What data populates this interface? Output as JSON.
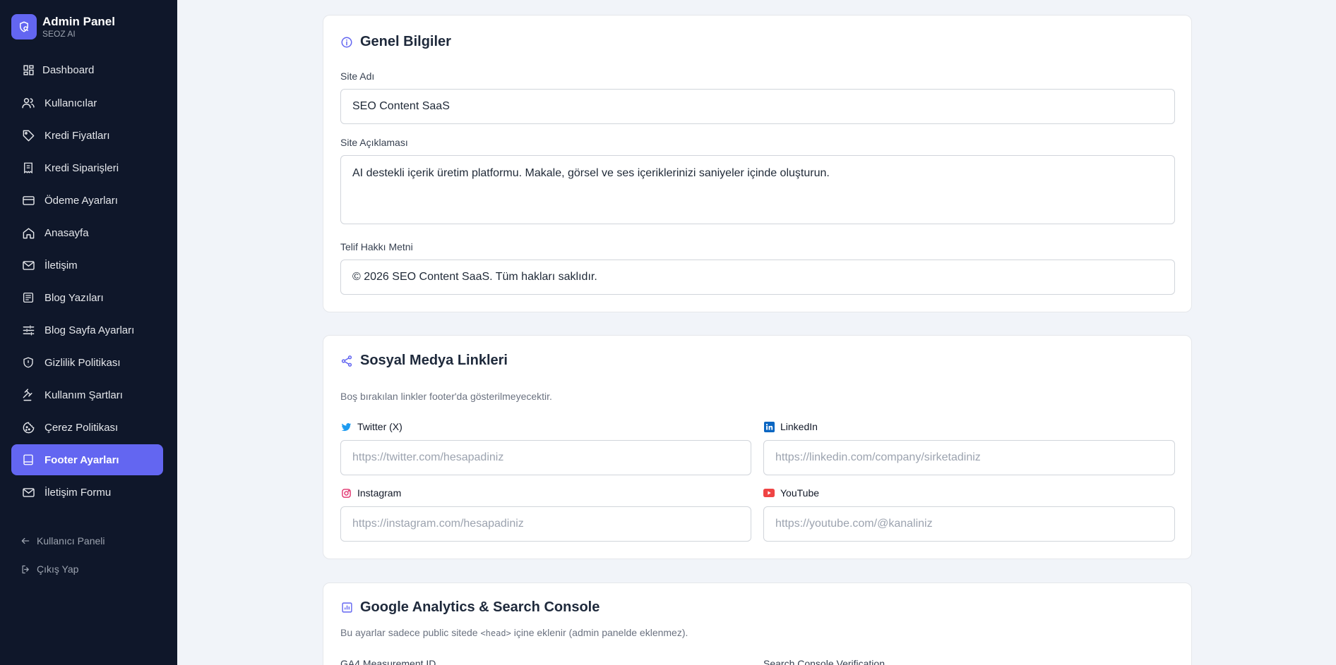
{
  "brand": {
    "title": "Admin Panel",
    "subtitle": "SEOZ AI"
  },
  "sidebar": {
    "items": [
      {
        "label": "Dashboard",
        "icon": "dashboard-icon"
      },
      {
        "label": "Kullanıcılar",
        "icon": "users-icon"
      },
      {
        "label": "Kredi Fiyatları",
        "icon": "tag-icon"
      },
      {
        "label": "Kredi Siparişleri",
        "icon": "receipt-icon"
      },
      {
        "label": "Ödeme Ayarları",
        "icon": "credit-card-icon"
      },
      {
        "label": "Anasayfa",
        "icon": "home-icon"
      },
      {
        "label": "İletişim",
        "icon": "mail-icon"
      },
      {
        "label": "Blog Yazıları",
        "icon": "article-icon"
      },
      {
        "label": "Blog Sayfa Ayarları",
        "icon": "sliders-icon"
      },
      {
        "label": "Gizlilik Politikası",
        "icon": "shield-icon"
      },
      {
        "label": "Kullanım Şartları",
        "icon": "gavel-icon"
      },
      {
        "label": "Çerez Politikası",
        "icon": "cookie-icon"
      },
      {
        "label": "Footer Ayarları",
        "icon": "footer-icon",
        "active": true
      },
      {
        "label": "İletişim Formu",
        "icon": "mail-icon"
      }
    ],
    "bottom": [
      {
        "label": "Kullanıcı Paneli",
        "icon": "arrow-left-icon"
      },
      {
        "label": "Çıkış Yap",
        "icon": "logout-icon"
      }
    ]
  },
  "general": {
    "title": "Genel Bilgiler",
    "site_name_label": "Site Adı",
    "site_name_value": "SEO Content SaaS",
    "site_desc_label": "Site Açıklaması",
    "site_desc_value": "AI destekli içerik üretim platformu. Makale, görsel ve ses içeriklerinizi saniyeler içinde oluşturun.",
    "copyright_label": "Telif Hakkı Metni",
    "copyright_value": "© 2026 SEO Content SaaS. Tüm hakları saklıdır."
  },
  "social": {
    "title": "Sosyal Medya Linkleri",
    "hint": "Boş bırakılan linkler footer'da gösterilmeyecektir.",
    "twitter_label": "Twitter (X)",
    "twitter_placeholder": "https://twitter.com/hesapadiniz",
    "linkedin_label": "LinkedIn",
    "linkedin_placeholder": "https://linkedin.com/company/sirketadiniz",
    "instagram_label": "Instagram",
    "instagram_placeholder": "https://instagram.com/hesapadiniz",
    "youtube_label": "YouTube",
    "youtube_placeholder": "https://youtube.com/@kanaliniz"
  },
  "analytics": {
    "title": "Google Analytics & Search Console",
    "hint_before": "Bu ayarlar sadece public sitede",
    "hint_code": "<head>",
    "hint_after": "içine eklenir (admin panelde eklenmez).",
    "ga4_label": "GA4 Measurement ID",
    "gsc_label": "Search Console Verification"
  },
  "colors": {
    "accent": "#6366f1",
    "sidebar_bg": "#0f172a",
    "page_bg": "#f1f4f9"
  }
}
